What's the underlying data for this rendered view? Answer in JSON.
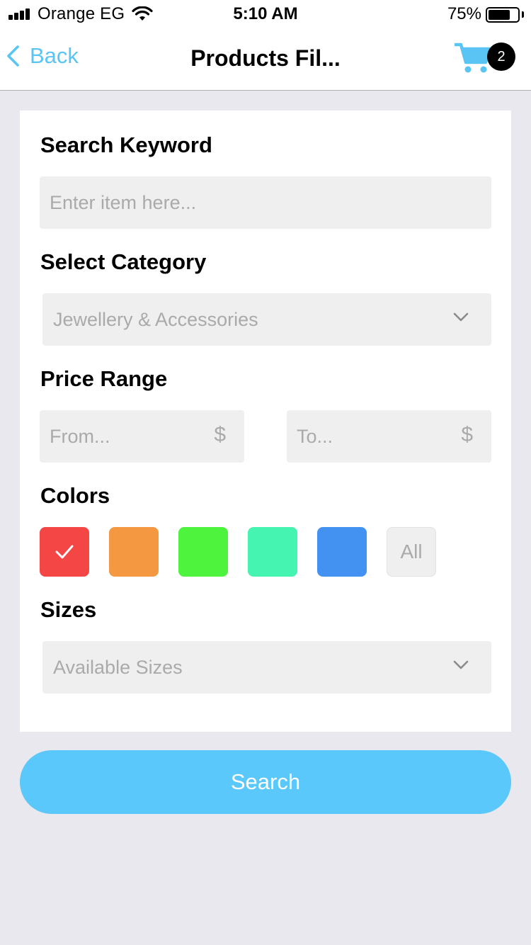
{
  "status_bar": {
    "carrier": "Orange EG",
    "time": "5:10 AM",
    "battery_percent": "75%",
    "battery_level": 0.75
  },
  "nav": {
    "back_label": "Back",
    "title": "Products Fil...",
    "cart_icon": "cart-icon",
    "cart_count": "2",
    "accent_color": "#5ac4f5"
  },
  "filters": {
    "keyword": {
      "label": "Search Keyword",
      "placeholder": "Enter item here...",
      "value": ""
    },
    "category": {
      "label": "Select Category",
      "selected": "Jewellery & Accessories"
    },
    "price": {
      "label": "Price Range",
      "from_placeholder": "From...",
      "to_placeholder": "To...",
      "currency": "$"
    },
    "colors": {
      "label": "Colors",
      "swatches": [
        {
          "name": "red",
          "hex": "#f44645",
          "selected": true
        },
        {
          "name": "orange",
          "hex": "#f49942",
          "selected": false
        },
        {
          "name": "green",
          "hex": "#4ef33e",
          "selected": false
        },
        {
          "name": "mint",
          "hex": "#44f4b0",
          "selected": false
        },
        {
          "name": "blue",
          "hex": "#4392f2",
          "selected": false
        }
      ],
      "all_label": "All"
    },
    "sizes": {
      "label": "Sizes",
      "selected": "Available Sizes"
    }
  },
  "search_button": {
    "label": "Search",
    "color": "#5ac8fa"
  }
}
